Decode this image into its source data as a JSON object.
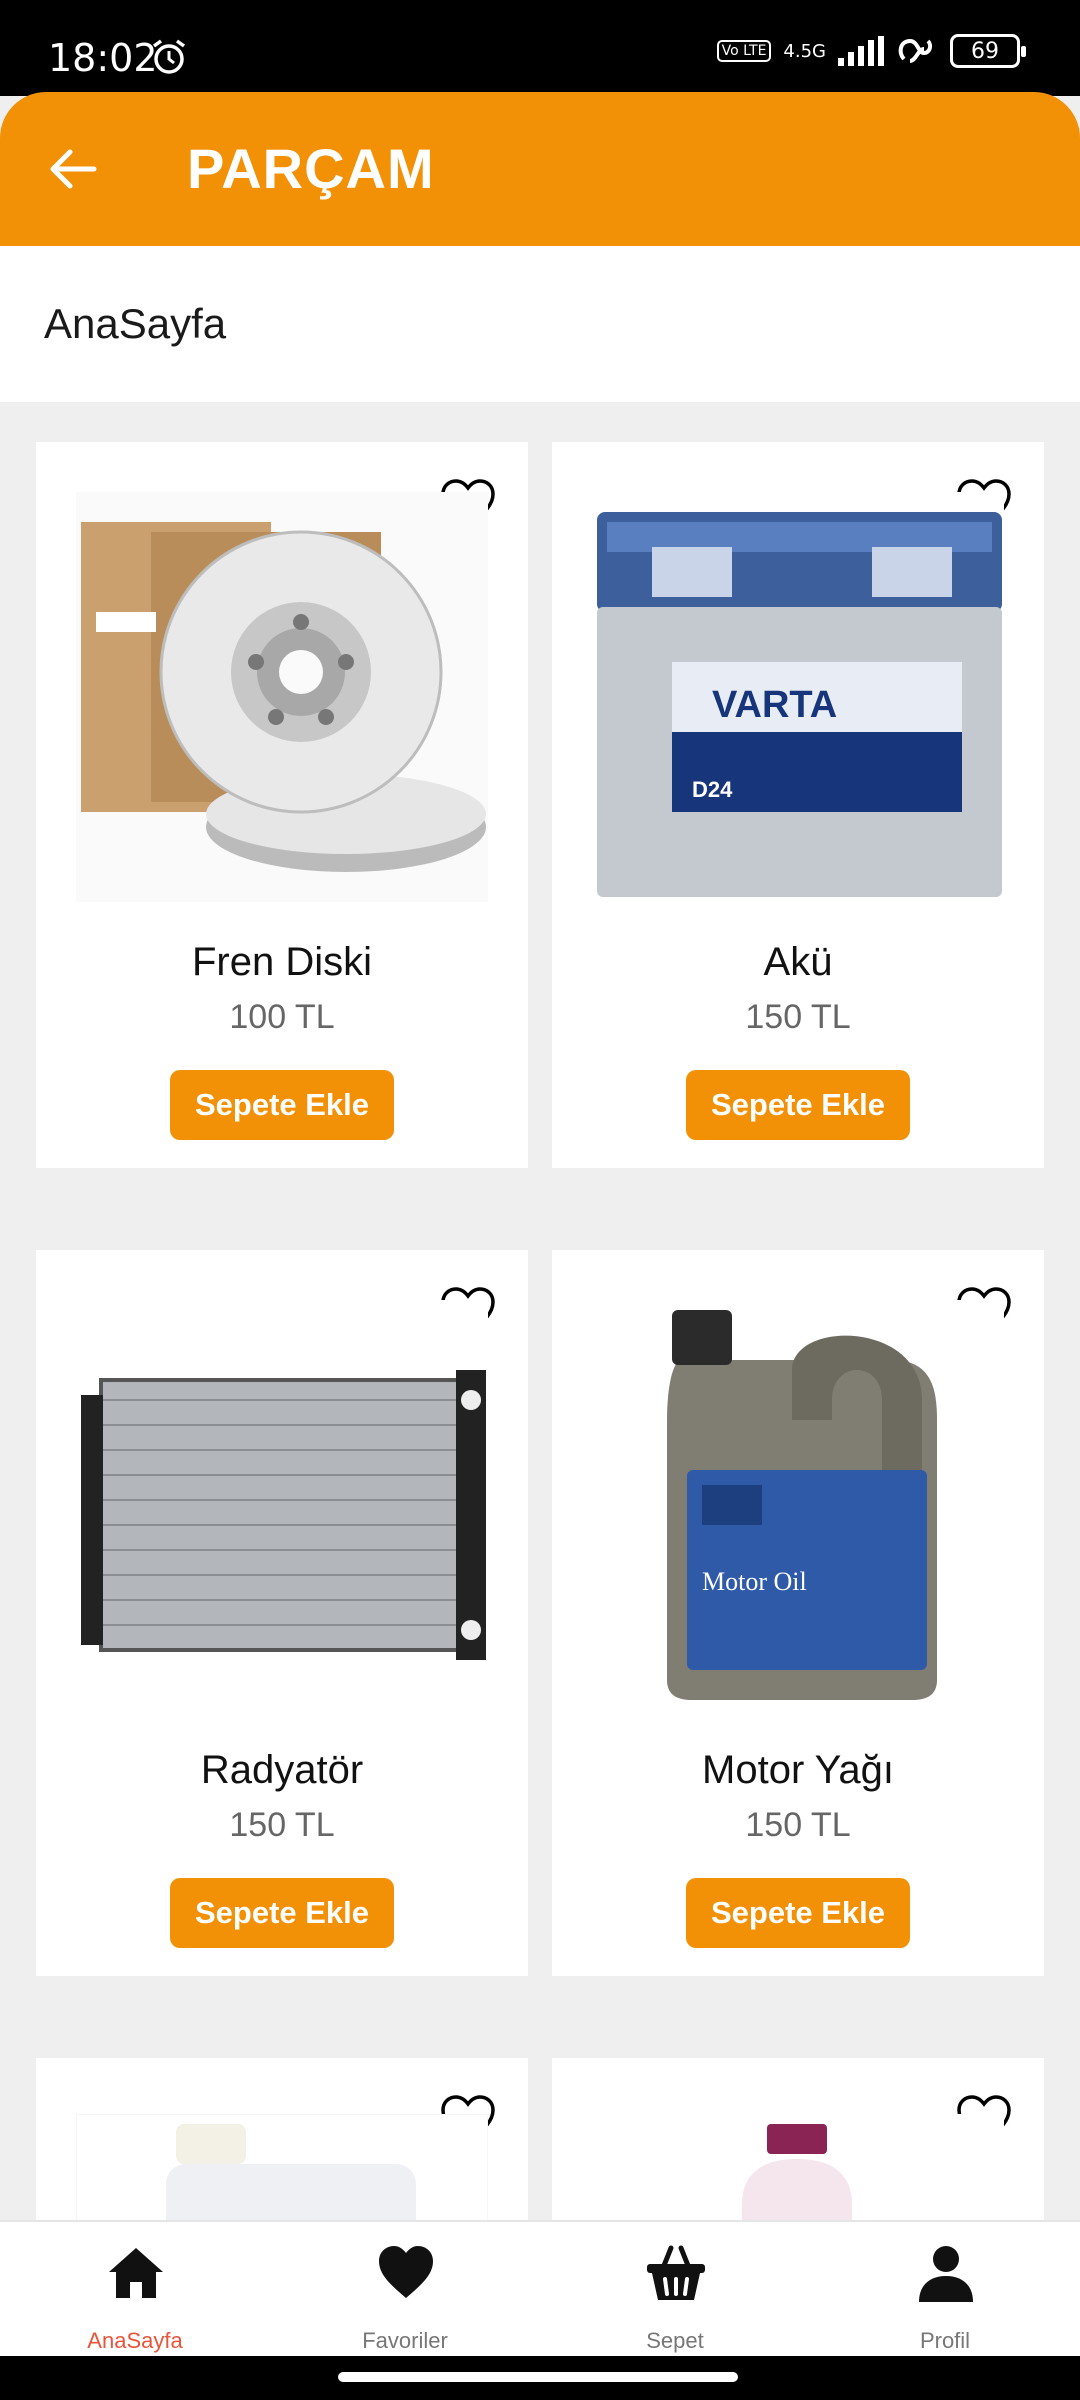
{
  "status": {
    "time": "18:02",
    "volte": "Vo LTE",
    "network": "4.5G",
    "battery": "69"
  },
  "appbar": {
    "title": "PARÇAM",
    "back_icon": "arrow-left-icon"
  },
  "breadcrumb": "AnaSayfa",
  "products": [
    {
      "name": "Fren Diski",
      "price": "100 TL",
      "button": "Sepete Ekle",
      "image": "brake-disc"
    },
    {
      "name": "Akü",
      "price": "150 TL",
      "button": "Sepete Ekle",
      "image": "car-battery"
    },
    {
      "name": "Radyatör",
      "price": "150 TL",
      "button": "Sepete Ekle",
      "image": "radiator"
    },
    {
      "name": "Motor Yağı",
      "price": "150 TL",
      "button": "Sepete Ekle",
      "image": "motor-oil"
    }
  ],
  "nav": [
    {
      "label": "AnaSayfa",
      "icon": "home-icon",
      "active": true
    },
    {
      "label": "Favoriler",
      "icon": "heart-icon",
      "active": false
    },
    {
      "label": "Sepet",
      "icon": "basket-icon",
      "active": false
    },
    {
      "label": "Profil",
      "icon": "person-icon",
      "active": false
    }
  ],
  "colors": {
    "accent": "#f39106",
    "active_nav": "#e8553b",
    "background": "#efefef"
  }
}
